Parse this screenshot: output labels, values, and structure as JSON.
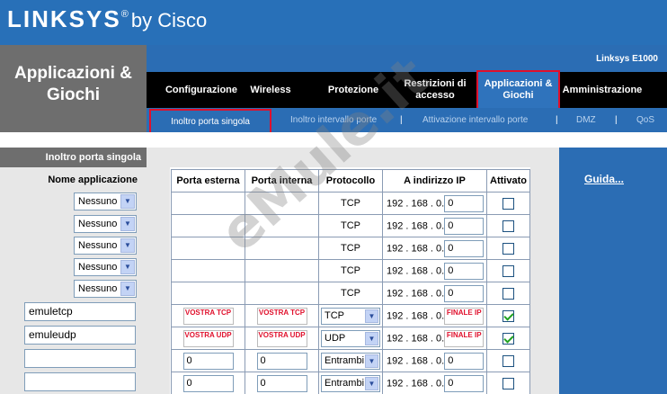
{
  "header": {
    "brand": "LINKSYS",
    "registered": "®",
    "by": "by Cisco"
  },
  "page_title": "Applicazioni &\nGiochi",
  "model": "Linksys E1000",
  "nav": [
    {
      "label": "Configurazione"
    },
    {
      "label": "Wireless"
    },
    {
      "label": "Protezione"
    },
    {
      "label": "Restrizioni di accesso"
    },
    {
      "label": "Applicazioni & Giochi",
      "active": true
    },
    {
      "label": "Amministrazione"
    }
  ],
  "subnav": [
    {
      "label": "Inoltro porta singola",
      "active": true
    },
    {
      "label": "Inoltro intervallo porte"
    },
    {
      "label": "Attivazione intervallo porte"
    },
    {
      "label": "DMZ"
    },
    {
      "label": "QoS"
    }
  ],
  "subnav_separator": "|",
  "sidebar": {
    "section_title": "Inoltro porta singola",
    "column_label": "Nome applicazione",
    "selects": [
      "Nessuno",
      "Nessuno",
      "Nessuno",
      "Nessuno",
      "Nessuno"
    ],
    "name_fields": [
      "emuletcp",
      "emuleudp",
      "",
      ""
    ]
  },
  "table": {
    "headers": [
      "Porta esterna",
      "Porta interna",
      "Protocollo",
      "A indirizzo IP",
      "Attivato"
    ],
    "ip_prefix": "192 . 168 . 0.",
    "rows": [
      {
        "ext": "",
        "int": "",
        "proto": "TCP",
        "ip": "0",
        "enabled": false
      },
      {
        "ext": "",
        "int": "",
        "proto": "TCP",
        "ip": "0",
        "enabled": false
      },
      {
        "ext": "",
        "int": "",
        "proto": "TCP",
        "ip": "0",
        "enabled": false
      },
      {
        "ext": "",
        "int": "",
        "proto": "TCP",
        "ip": "0",
        "enabled": false
      },
      {
        "ext": "",
        "int": "",
        "proto": "TCP",
        "ip": "0",
        "enabled": false
      },
      {
        "ext": "VOSTRA TCP",
        "int": "VOSTRA TCP",
        "proto": "TCP",
        "ip": "FINALE IP",
        "enabled": true
      },
      {
        "ext": "VOSTRA UDP",
        "int": "VOSTRA UDP",
        "proto": "UDP",
        "ip": "FINALE IP",
        "enabled": true
      },
      {
        "ext": "0",
        "int": "0",
        "proto": "Entrambi",
        "ip": "0",
        "enabled": false
      },
      {
        "ext": "0",
        "int": "0",
        "proto": "Entrambi",
        "ip": "0",
        "enabled": false
      }
    ]
  },
  "help": {
    "link": "Guida..."
  },
  "watermark": "eMule.it"
}
